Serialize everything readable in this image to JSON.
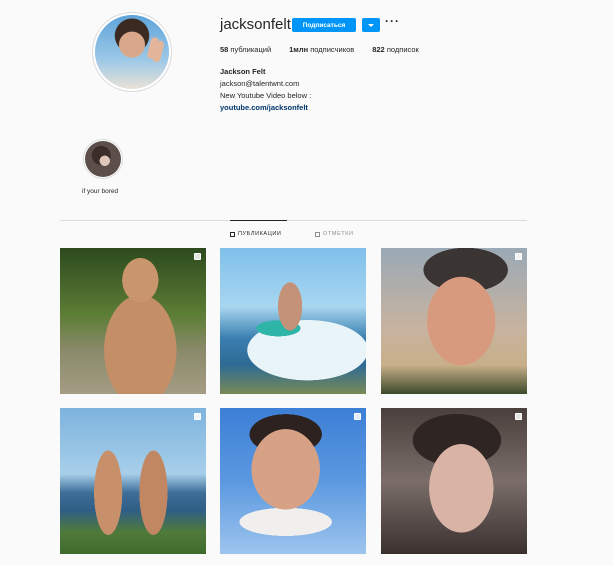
{
  "profile": {
    "username": "jacksonfelt",
    "follow_label": "Подписаться",
    "more_label": "···",
    "stats": {
      "posts_count": "58",
      "posts_label": " публикаций",
      "followers_count": "1млн",
      "followers_label": " подписчиков",
      "following_count": "822",
      "following_label": " подписок"
    },
    "bio": {
      "name": "Jackson Felt",
      "email": "jackson@talentwnt.com",
      "line": "New Youtube Video below :",
      "link": "youtube.com/jacksonfelt"
    }
  },
  "highlights": [
    {
      "label": "if your bored"
    }
  ],
  "tabs": {
    "posts": "ПУБЛИКАЦИИ",
    "tagged": "ОТМЕТКИ"
  },
  "icons": {
    "dropdown": "chevron-down-icon",
    "more": "more-dots-icon",
    "posts_tab": "grid-icon",
    "tagged_tab": "tag-icon",
    "multi_post": "multiple-photos-icon"
  },
  "colors": {
    "primary_button": "#0095f6",
    "link": "#00376b",
    "text": "#262626",
    "muted": "#8e8e8e",
    "background": "#fafafa"
  }
}
